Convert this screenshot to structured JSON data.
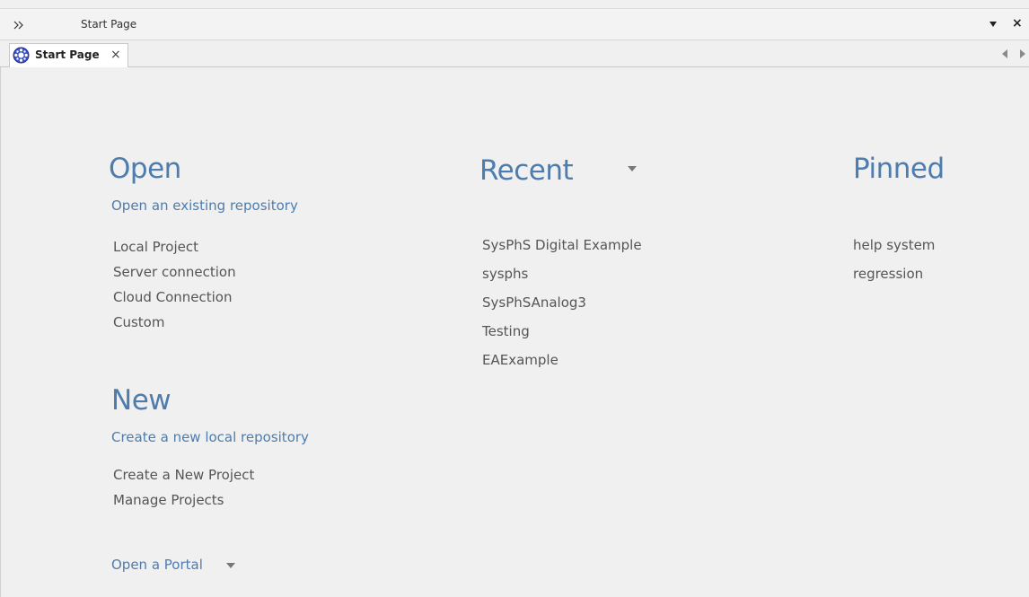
{
  "window": {
    "title": "Start Page"
  },
  "tab": {
    "label": "Start Page",
    "close": "×"
  },
  "open": {
    "heading": "Open",
    "sublink": "Open an existing repository",
    "items": [
      "Local Project",
      "Server connection",
      "Cloud Connection",
      "Custom"
    ]
  },
  "new": {
    "heading": "New",
    "sublink": "Create a new local repository",
    "items": [
      "Create a New Project",
      "Manage Projects"
    ]
  },
  "portal": {
    "label": "Open a Portal"
  },
  "recent": {
    "heading": "Recent",
    "items": [
      "SysPhS Digital Example",
      "sysphs",
      "SysPhSAnalog3",
      "Testing",
      "EAExample"
    ]
  },
  "pinned": {
    "heading": "Pinned",
    "items": [
      "help system",
      "regression"
    ]
  },
  "colors": {
    "accent": "#4e7cad",
    "text": "#555555",
    "background": "#f0f0f0"
  }
}
